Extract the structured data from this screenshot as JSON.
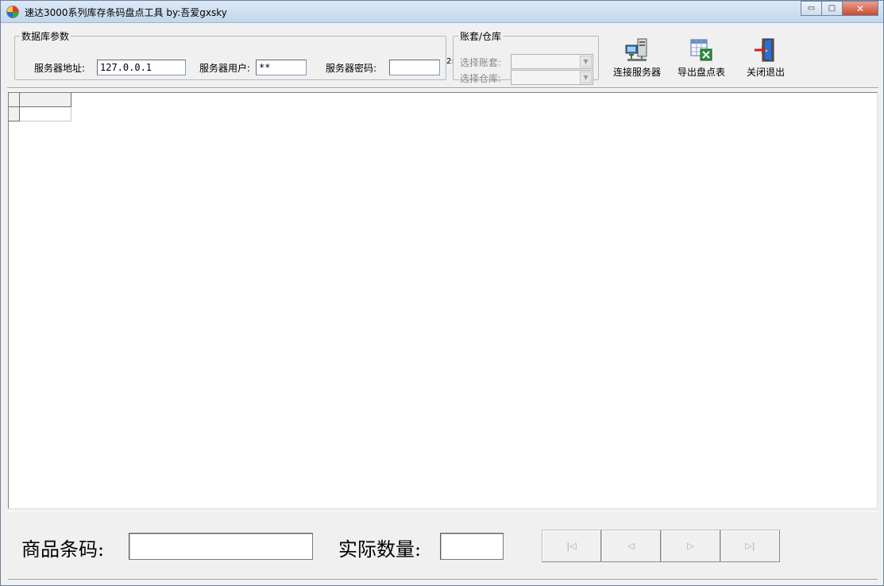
{
  "window": {
    "title": "速达3000系列库存条码盘点工具 by:吾爱gxsky",
    "controls": {
      "minimize": "▭",
      "maximize": "□",
      "close": "✕"
    }
  },
  "db_params": {
    "legend": "数据库参数",
    "server_address_label": "服务器地址:",
    "server_address_value": "127.0.0.1",
    "server_user_label": "服务器用户:",
    "server_user_value": "**",
    "server_password_label": "服务器密码:",
    "server_password_value": "",
    "clipped_text": "2:"
  },
  "account": {
    "legend": "账套/仓库",
    "select_account_label": "选择账套:",
    "select_warehouse_label": "选择仓库:"
  },
  "toolbar": {
    "connect_label": "连接服务器",
    "export_label": "导出盘点表",
    "exit_label": "关闭退出"
  },
  "bottom": {
    "barcode_label": "商品条码:",
    "barcode_value": "",
    "quantity_label": "实际数量:",
    "quantity_value": "",
    "nav": {
      "first": "|◁",
      "prev": "◁",
      "next": "▷",
      "last": "▷|"
    }
  }
}
